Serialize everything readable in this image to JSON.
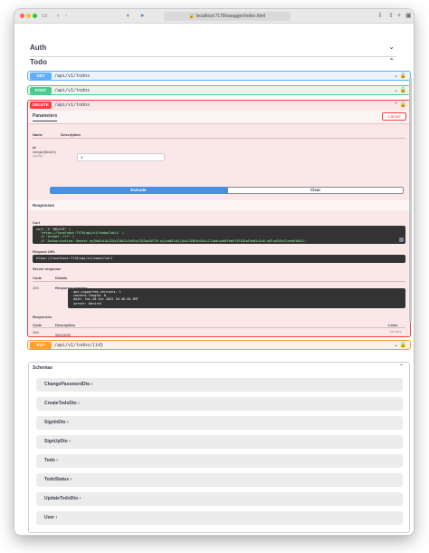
{
  "browser": {
    "url": "localhost:7178/swagger/index.html"
  },
  "sections": {
    "auth": "Auth",
    "todo": "Todo"
  },
  "operations": {
    "get": {
      "method": "GET",
      "path": "/api/v1/todos"
    },
    "post": {
      "method": "POST",
      "path": "/api/v1/todos"
    },
    "delete": {
      "method": "DELETE",
      "path": "/api/v1/todos"
    },
    "put": {
      "method": "PUT",
      "path": "/api/v1/todos/{id}"
    }
  },
  "delete_panel": {
    "tab": "Parameters",
    "cancel": "Cancel",
    "col_name": "Name",
    "col_description": "Description",
    "param_name": "id",
    "param_type": "integer($int32)",
    "param_location": "(query)",
    "param_value": "1",
    "execute": "Execute",
    "clear": "Clear",
    "responses_title": "Responses",
    "curl_label": "Curl",
    "curl_lines": [
      "curl -X 'DELETE' \\",
      "  'https://localhost:7178/api/v1/todos?id=1' \\",
      "  -H 'accept: */*' \\",
      "  -H 'Authorization: Bearer eyJhbGciOiJIUzI1NiIsInR5cCI6IkpXVCJ9.eyJzdWIiOiJjbXl3ZWJhcGkiLCJ1bmlxdWVfbmFtZSI6ImFkbWluIn0.aGFzaGVkc2lnbmF0dXJl'"
    ],
    "request_url_label": "Request URL",
    "request_url": "https://localhost:7178/api/v1/todos?id=1",
    "server_response_label": "Server response",
    "code_label": "Code",
    "details_label": "Details",
    "server_code": "200",
    "response_headers_label": "Response headers",
    "response_headers": [
      " api-supported-versions: 1",
      " content-length: 0",
      " date: Sun,30 Oct 2022 10:46:28 GMT",
      " server: Kestrel"
    ],
    "responses_label": "Responses",
    "description_label": "Description",
    "links_label": "Links",
    "resp_code": "200",
    "resp_description": "Success",
    "resp_links": "No links"
  },
  "schemas": {
    "title": "Schemas",
    "models": [
      "ChangePasswordDto",
      "CreateTodoDto",
      "SignInDto",
      "SignUpDto",
      "Todo",
      "TodoStatus",
      "UpdateTodoDto",
      "User"
    ]
  }
}
